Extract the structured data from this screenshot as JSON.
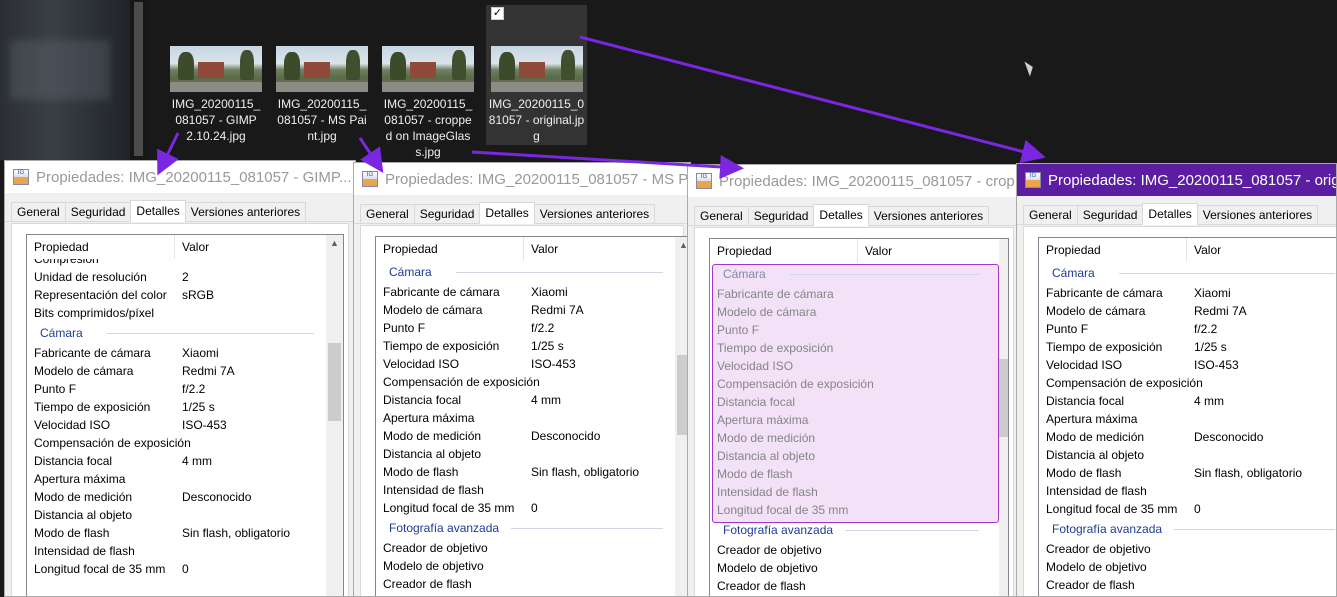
{
  "explorer": {
    "files": [
      {
        "name": "IMG_20200115_081057 - GIMP 2.10.24.jpg",
        "selected": false
      },
      {
        "name": "IMG_20200115_081057 - MS Paint.jpg",
        "selected": false
      },
      {
        "name": "IMG_20200115_081057 - cropped on ImageGlass.jpg",
        "selected": false
      },
      {
        "name": "IMG_20200115_081057 - original.jpg",
        "selected": true,
        "checkbox": "✓"
      }
    ]
  },
  "annotation_color": "#7b26e0",
  "tabs": [
    "General",
    "Seguridad",
    "Detalles",
    "Versiones anteriores"
  ],
  "columns": {
    "property": "Propiedad",
    "value": "Valor"
  },
  "icons": {
    "close": "✕",
    "scroll_up": "▲",
    "app_logo": "IG"
  },
  "groups": {
    "camera": "Cámara",
    "advanced": "Fotografía avanzada"
  },
  "dialogs": [
    {
      "title": "Propiedades: IMG_20200115_081057 - GIMP...",
      "pre_rows": [
        [
          "Compresión",
          ""
        ],
        [
          "Unidad de resolución",
          "2"
        ],
        [
          "Representación del color",
          "sRGB"
        ],
        [
          "Bits comprimidos/píxel",
          ""
        ]
      ],
      "camera_rows": [
        [
          "Fabricante de cámara",
          "Xiaomi"
        ],
        [
          "Modelo de cámara",
          "Redmi 7A"
        ],
        [
          "Punto F",
          "f/2.2"
        ],
        [
          "Tiempo de exposición",
          "1/25 s"
        ],
        [
          "Velocidad ISO",
          "ISO-453"
        ],
        [
          "Compensación de exposición",
          ""
        ],
        [
          "Distancia focal",
          "4 mm"
        ],
        [
          "Apertura máxima",
          ""
        ],
        [
          "Modo de medición",
          "Desconocido"
        ],
        [
          "Distancia al objeto",
          ""
        ],
        [
          "Modo de flash",
          "Sin flash, obligatorio"
        ],
        [
          "Intensidad de flash",
          ""
        ],
        [
          "Longitud focal de 35 mm",
          "0"
        ]
      ],
      "advanced_rows": []
    },
    {
      "title": "Propiedades: IMG_20200115_081057 - MS P...",
      "pre_rows": [],
      "camera_rows": [
        [
          "Fabricante de cámara",
          "Xiaomi"
        ],
        [
          "Modelo de cámara",
          "Redmi 7A"
        ],
        [
          "Punto F",
          "f/2.2"
        ],
        [
          "Tiempo de exposición",
          "1/25 s"
        ],
        [
          "Velocidad ISO",
          "ISO-453"
        ],
        [
          "Compensación de exposición",
          ""
        ],
        [
          "Distancia focal",
          "4 mm"
        ],
        [
          "Apertura máxima",
          ""
        ],
        [
          "Modo de medición",
          "Desconocido"
        ],
        [
          "Distancia al objeto",
          ""
        ],
        [
          "Modo de flash",
          "Sin flash, obligatorio"
        ],
        [
          "Intensidad de flash",
          ""
        ],
        [
          "Longitud focal de 35 mm",
          "0"
        ]
      ],
      "advanced_rows": [
        [
          "Creador de objetivo",
          ""
        ],
        [
          "Modelo de objetivo",
          ""
        ],
        [
          "Creador de flash",
          ""
        ]
      ]
    },
    {
      "title": "Propiedades: IMG_20200115_081057 - crop...",
      "pre_rows": [],
      "camera_rows": [
        [
          "Fabricante de cámara",
          ""
        ],
        [
          "Modelo de cámara",
          ""
        ],
        [
          "Punto F",
          ""
        ],
        [
          "Tiempo de exposición",
          ""
        ],
        [
          "Velocidad ISO",
          ""
        ],
        [
          "Compensación de exposición",
          ""
        ],
        [
          "Distancia focal",
          ""
        ],
        [
          "Apertura máxima",
          ""
        ],
        [
          "Modo de medición",
          ""
        ],
        [
          "Distancia al objeto",
          ""
        ],
        [
          "Modo de flash",
          ""
        ],
        [
          "Intensidad de flash",
          ""
        ],
        [
          "Longitud focal de 35 mm",
          ""
        ]
      ],
      "advanced_rows": [
        [
          "Creador de objetivo",
          ""
        ],
        [
          "Modelo de objetivo",
          ""
        ],
        [
          "Creador de flash",
          ""
        ]
      ]
    },
    {
      "title": "Propiedades: IMG_20200115_081057 - origi...",
      "pre_rows": [],
      "camera_rows": [
        [
          "Fabricante de cámara",
          "Xiaomi"
        ],
        [
          "Modelo de cámara",
          "Redmi 7A"
        ],
        [
          "Punto F",
          "f/2.2"
        ],
        [
          "Tiempo de exposición",
          "1/25 s"
        ],
        [
          "Velocidad ISO",
          "ISO-453"
        ],
        [
          "Compensación de exposición",
          ""
        ],
        [
          "Distancia focal",
          "4 mm"
        ],
        [
          "Apertura máxima",
          ""
        ],
        [
          "Modo de medición",
          "Desconocido"
        ],
        [
          "Distancia al objeto",
          ""
        ],
        [
          "Modo de flash",
          "Sin flash, obligatorio"
        ],
        [
          "Intensidad de flash",
          ""
        ],
        [
          "Longitud focal de 35 mm",
          "0"
        ]
      ],
      "advanced_rows": [
        [
          "Creador de objetivo",
          ""
        ],
        [
          "Modelo de objetivo",
          ""
        ],
        [
          "Creador de flash",
          ""
        ]
      ]
    }
  ]
}
